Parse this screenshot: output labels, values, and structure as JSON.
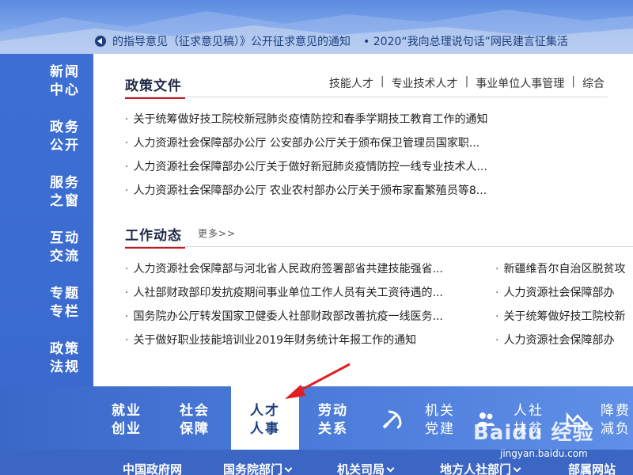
{
  "ticker": {
    "item1": "的指导意见（征求意见稿）》公开征求意见的通知",
    "item2": "• 2020“我向总理说句话”网民建言征集活"
  },
  "leftnav": {
    "items": [
      "新闻\n中心",
      "政务\n公开",
      "服务\n之窗",
      "互动\n交流",
      "专题\n专栏",
      "政策\n法规"
    ]
  },
  "policy": {
    "title": "政策文件",
    "tabs": [
      "技能人才",
      "专业技术人才",
      "事业单位人事管理",
      "综合"
    ],
    "separator": "|",
    "items": [
      "关于统筹做好技工院校新冠肺炎疫情防控和春季学期技工教育工作的通知",
      "人力资源社会保障部办公厅 公安部办公厅关于颁布保卫管理员国家职...",
      "人力资源社会保障部办公厅关于做好新冠肺炎疫情防控一线专业技术人...",
      "人力资源社会保障部办公厅 农业农村部办公厅关于颁布家畜繁殖员等8..."
    ]
  },
  "work": {
    "title": "工作动态",
    "more": "更多>>",
    "left_items": [
      "人力资源社会保障部与河北省人民政府签署部省共建技能强省...",
      "人社部财政部印发抗疫期间事业单位工作人员有关工资待遇的...",
      "国务院办公厅转发国家卫健委人社部财政部改善抗疫一线医务...",
      "关于做好职业技能培训业2019年财务统计年报工作的通知"
    ],
    "right_items": [
      "新疆维吾尔自治区脱贫攻",
      "人力资源社会保障部办",
      "关于统筹做好技工院校新",
      "人力资源社会保障部办"
    ]
  },
  "categories": {
    "jiuye": "就业\n创业",
    "shebao": "社会\n保障",
    "rencai": "人才\n人事",
    "laodong": "劳动\n关系",
    "jiguan": "机关\n党建",
    "renshe": "人社\n扶贫",
    "jiangfei": "降费\n减负"
  },
  "links": {
    "gov": "中国政府网",
    "state": "国务院部门",
    "office": "机关司局",
    "local": "地方人社部门",
    "sites": "部属网站"
  },
  "watermark": {
    "brand": "Baidu 经验",
    "url": "jingyan.baidu.com"
  },
  "colors": {
    "accent_red": "#c8161e",
    "nav_blue": "#3a6acd",
    "arrow_red": "#e02020"
  }
}
